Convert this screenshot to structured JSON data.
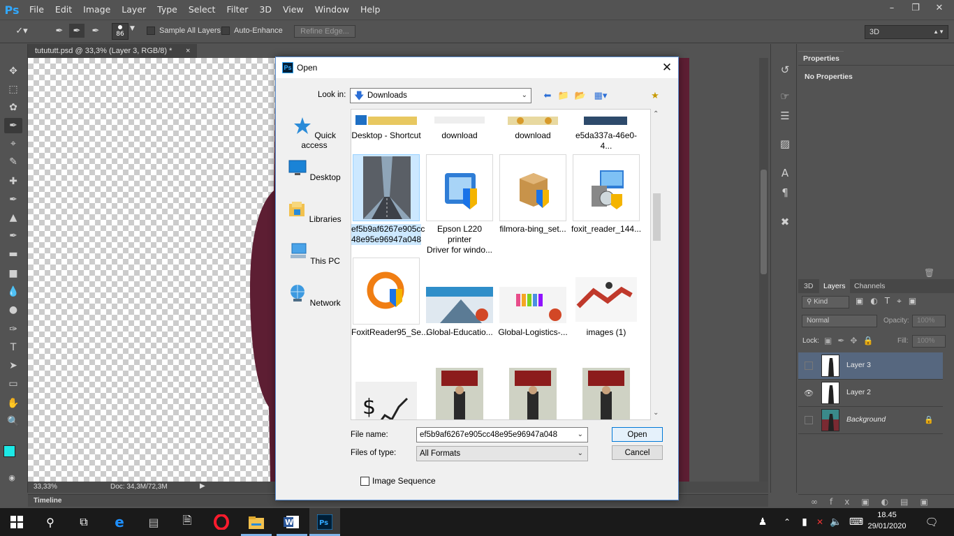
{
  "app": {
    "logo": "Ps",
    "menu": [
      "File",
      "Edit",
      "Image",
      "Layer",
      "Type",
      "Select",
      "Filter",
      "3D",
      "View",
      "Window",
      "Help"
    ]
  },
  "options_bar": {
    "brush_size": "86",
    "sample_all_layers": "Sample All Layers",
    "auto_enhance": "Auto-Enhance",
    "refine_edge": "Refine Edge...",
    "workspace": "3D"
  },
  "document": {
    "tab_title": "tutututt.psd @ 33,3% (Layer 3, RGB/8) *",
    "zoom": "33,33%",
    "doc_size": "Doc: 34,3M/72,3M",
    "timeline": "Timeline"
  },
  "panels": {
    "properties_tab": "Properties",
    "properties_body": "No Properties",
    "layer_tabs": [
      "3D",
      "Layers",
      "Channels"
    ],
    "kind": "Kind",
    "blend_mode": "Normal",
    "opacity_label": "Opacity:",
    "opacity_value": "100%",
    "lock_label": "Lock:",
    "fill_label": "Fill:",
    "fill_value": "100%",
    "layers": [
      {
        "name": "Layer 3",
        "visible": false,
        "selected": true
      },
      {
        "name": "Layer 2",
        "visible": true,
        "selected": false
      },
      {
        "name": "Background",
        "visible": false,
        "selected": false,
        "locked": true
      }
    ]
  },
  "dialog": {
    "title": "Open",
    "look_in_label": "Look in:",
    "look_in_value": "Downloads",
    "places": [
      "Quick access",
      "Desktop",
      "Libraries",
      "This PC",
      "Network"
    ],
    "files": [
      {
        "label": "Desktop - Shortcut"
      },
      {
        "label": "download"
      },
      {
        "label": "download"
      },
      {
        "label": "e5da337a-46e0-4..."
      },
      {
        "label": "ef5b9af6267e905cc\n48e95e96947a048",
        "selected": true
      },
      {
        "label": "Epson L220 printer\nDriver for windo..."
      },
      {
        "label": "filmora-bing_set..."
      },
      {
        "label": "foxit_reader_144..."
      },
      {
        "label": "FoxitReader95_Se..."
      },
      {
        "label": "Global-Educatio..."
      },
      {
        "label": "Global-Logistics-..."
      },
      {
        "label": "images (1)"
      },
      {
        "label": ""
      },
      {
        "label": ""
      },
      {
        "label": ""
      },
      {
        "label": ""
      }
    ],
    "file_name_label": "File name:",
    "file_name_value": "ef5b9af6267e905cc48e95e96947a048",
    "files_of_type_label": "Files of type:",
    "files_of_type_value": "All Formats",
    "open_button": "Open",
    "cancel_button": "Cancel",
    "image_sequence": "Image Sequence"
  },
  "taskbar": {
    "time": "18.45",
    "date": "29/01/2020"
  },
  "colors": {
    "foreground": "#1de9e6",
    "background": "#ffffff",
    "ps_accent": "#31a8ff"
  }
}
